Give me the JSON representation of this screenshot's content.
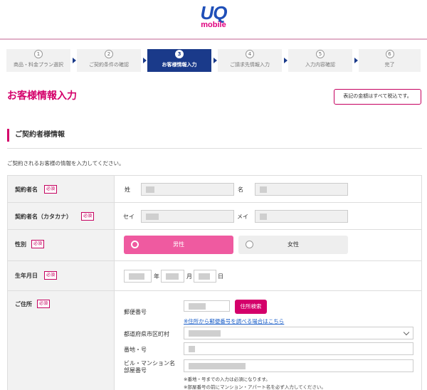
{
  "brand": {
    "logo_main": "UQ",
    "logo_sub": "mobile"
  },
  "steps": [
    {
      "num": "1",
      "label": "商品・料金プラン選択",
      "active": false
    },
    {
      "num": "2",
      "label": "ご契約条件の確認",
      "active": false
    },
    {
      "num": "3",
      "label": "お客様情報入力",
      "active": true
    },
    {
      "num": "4",
      "label": "ご請求先情報入力",
      "active": false
    },
    {
      "num": "5",
      "label": "入力内容確認",
      "active": false
    },
    {
      "num": "6",
      "label": "完了",
      "active": false
    }
  ],
  "page_title": "お客様情報入力",
  "tax_note": "表記の金額はすべて税込です。",
  "section_title": "ご契約者様情報",
  "intro": "ご契約されるお客様の情報を入力してください。",
  "required_label": "必須",
  "form": {
    "name": {
      "label": "契約者名",
      "sei": "姓",
      "mei": "名"
    },
    "kana": {
      "label": "契約者名（カタカナ）",
      "sei": "セイ",
      "mei": "メイ"
    },
    "gender": {
      "label": "性別",
      "male": "男性",
      "female": "女性",
      "selected": "男性"
    },
    "birth": {
      "label": "生年月日",
      "year": "年",
      "month": "月",
      "day": "日"
    },
    "address": {
      "label": "ご住所",
      "postal_label": "郵便番号",
      "search_button": "住所検索",
      "postal_link": "※住所から郵便番号を調べる場合はこちら",
      "pref_label": "都道府県市区町村",
      "street_label": "番地・号",
      "building_label_1": "ビル・マンション名",
      "building_label_2": "部屋番号",
      "note1": "※番地・号までの入力は必須になります。",
      "note2": "※部屋番号の前にマンション・アパート名を必ず入力してください。"
    }
  },
  "colors": {
    "accent": "#d4006a",
    "nav_active": "#1a3a8a",
    "male_selected": "#ef5aa0",
    "link": "#1a5ec8"
  }
}
